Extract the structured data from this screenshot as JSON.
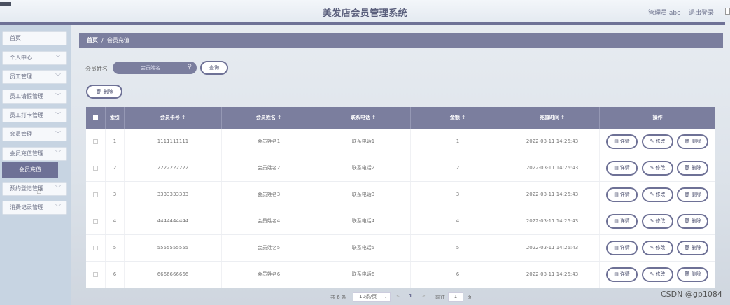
{
  "header": {
    "title": "美发店会员管理系统",
    "admin": "管理员 abo",
    "logout": "退出登录"
  },
  "sidebar": {
    "items": [
      {
        "label": "首页",
        "has_chevron": false
      },
      {
        "label": "个人中心",
        "has_chevron": true
      },
      {
        "label": "员工管理",
        "has_chevron": true
      },
      {
        "label": "员工请假管理",
        "has_chevron": true
      },
      {
        "label": "员工打卡管理",
        "has_chevron": true
      },
      {
        "label": "会员管理",
        "has_chevron": true
      },
      {
        "label": "会员充值管理",
        "has_chevron": true
      },
      {
        "label": "预约登记管理",
        "has_chevron": true
      },
      {
        "label": "消费记录管理",
        "has_chevron": true
      }
    ],
    "active_sub": "会员充值"
  },
  "breadcrumb": {
    "home": "首页",
    "separator": "/",
    "current": "会员充值"
  },
  "search": {
    "label": "会员姓名",
    "placeholder": "会员姓名",
    "value": "",
    "query_button": "查询",
    "delete_button": "删除"
  },
  "table": {
    "columns": [
      "索引",
      "会员卡号 ⇕",
      "会员姓名 ⇕",
      "联系电话 ⇕",
      "金额 ⇕",
      "充值时间 ⇕",
      "操作"
    ],
    "rows": [
      {
        "index": "1",
        "card": "1111111111",
        "name": "会员姓名1",
        "phone": "联系电话1",
        "amount": "1",
        "time": "2022-03-11 14:26:43"
      },
      {
        "index": "2",
        "card": "2222222222",
        "name": "会员姓名2",
        "phone": "联系电话2",
        "amount": "2",
        "time": "2022-03-11 14:26:43"
      },
      {
        "index": "3",
        "card": "3333333333",
        "name": "会员姓名3",
        "phone": "联系电话3",
        "amount": "3",
        "time": "2022-03-11 14:26:43"
      },
      {
        "index": "4",
        "card": "4444444444",
        "name": "会员姓名4",
        "phone": "联系电话4",
        "amount": "4",
        "time": "2022-03-11 14:26:43"
      },
      {
        "index": "5",
        "card": "5555555555",
        "name": "会员姓名5",
        "phone": "联系电话5",
        "amount": "5",
        "time": "2022-03-11 14:26:43"
      },
      {
        "index": "6",
        "card": "6666666666",
        "name": "会员姓名6",
        "phone": "联系电话6",
        "amount": "6",
        "time": "2022-03-11 14:26:43"
      }
    ],
    "actions": {
      "detail": "详情",
      "edit": "修改",
      "delete": "删除"
    }
  },
  "pagination": {
    "total": "共 6 条",
    "page_size": "10条/页",
    "prev": "<",
    "current_page": "1",
    "next": ">",
    "goto_label": "前往",
    "goto_value": "1",
    "page_suffix": "页"
  },
  "watermark": "CSDN @gp1084",
  "colors": {
    "accent": "#7b7e9e",
    "accent_dark": "#6e7196",
    "sidebar_bg": "#c7d4e2"
  }
}
